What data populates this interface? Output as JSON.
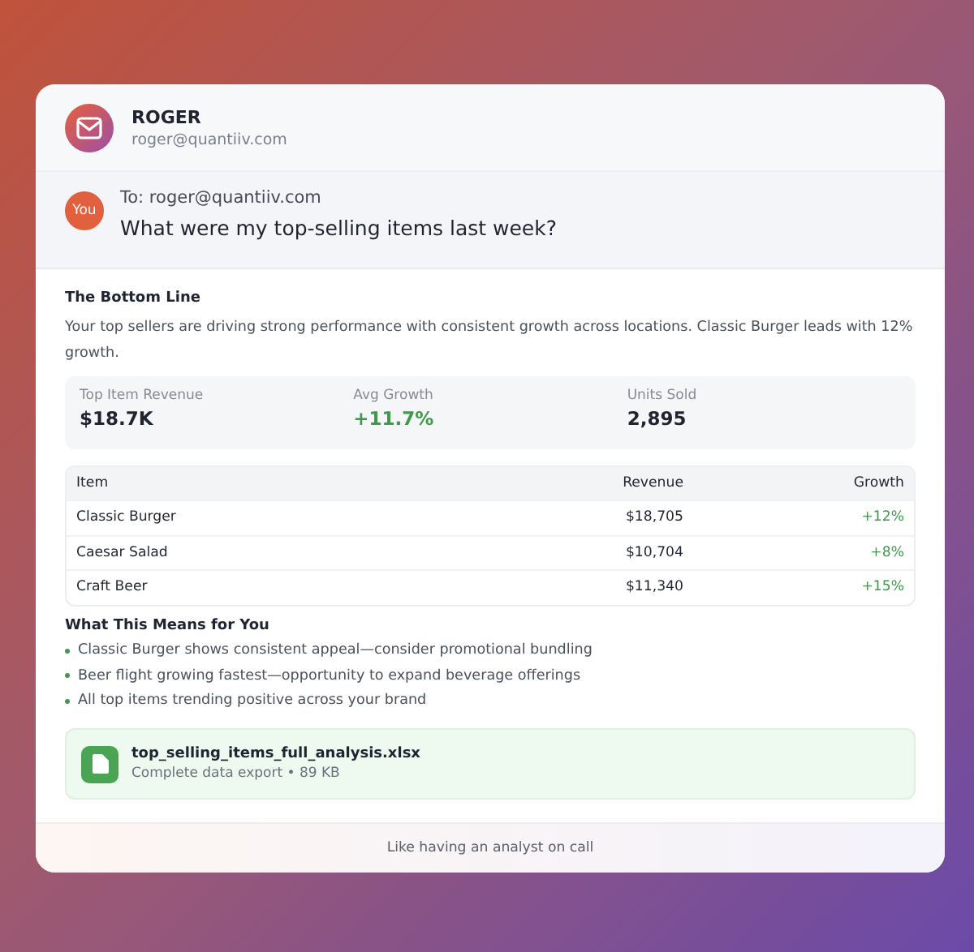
{
  "sender": {
    "name": "ROGER",
    "email": "roger@quantiiv.com"
  },
  "question": {
    "avatar": "You",
    "to": "To: roger@quantiiv.com",
    "text": "What were my top-selling items last week?"
  },
  "summary": {
    "heading": "The Bottom Line",
    "text": "Your top sellers are driving strong performance with consistent growth across locations. Classic Burger leads with 12% growth."
  },
  "metrics": [
    {
      "label": "Top Item Revenue",
      "value": "$18.7K",
      "positive": false
    },
    {
      "label": "Avg Growth",
      "value": "+11.7%",
      "positive": true
    },
    {
      "label": "Units Sold",
      "value": "2,895",
      "positive": false
    }
  ],
  "table": {
    "columns": [
      "Item",
      "Revenue",
      "Growth"
    ],
    "rows": [
      [
        "Classic Burger",
        "$18,705",
        "+12%"
      ],
      [
        "Caesar Salad",
        "$10,704",
        "+8%"
      ],
      [
        "Craft Beer",
        "$11,340",
        "+15%"
      ]
    ]
  },
  "insights": {
    "heading": "What This Means for You",
    "items": [
      "Classic Burger shows consistent appeal—consider promotional bundling",
      "Beer flight growing fastest—opportunity to expand beverage offerings",
      "All top items trending positive across your brand"
    ]
  },
  "attachment": {
    "name": "top_selling_items_full_analysis.xlsx",
    "meta": "Complete data export • 89 KB"
  },
  "footer": "Like having an analyst on call"
}
